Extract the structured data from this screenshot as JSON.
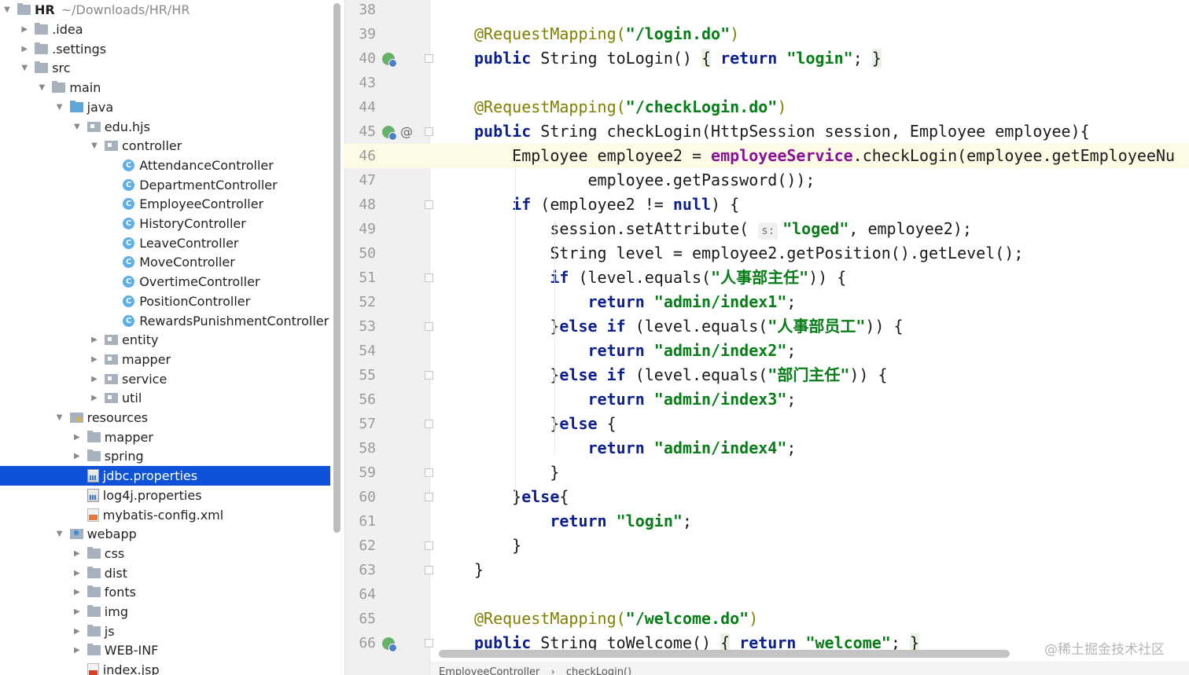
{
  "project": {
    "name": "HR",
    "path": "~/Downloads/HR/HR"
  },
  "tree": [
    {
      "label": "HR",
      "arrow": "▼",
      "icon": "folder",
      "indent": 0,
      "bold": true,
      "path": "~/Downloads/HR/HR"
    },
    {
      "label": ".idea",
      "arrow": "▶",
      "icon": "folder",
      "indent": 1
    },
    {
      "label": ".settings",
      "arrow": "▶",
      "icon": "folder",
      "indent": 1
    },
    {
      "label": "src",
      "arrow": "▼",
      "icon": "folder",
      "indent": 1
    },
    {
      "label": "main",
      "arrow": "▼",
      "icon": "folder",
      "indent": 2
    },
    {
      "label": "java",
      "arrow": "▼",
      "icon": "folder-blue",
      "indent": 3
    },
    {
      "label": "edu.hjs",
      "arrow": "▼",
      "icon": "pkg",
      "indent": 4
    },
    {
      "label": "controller",
      "arrow": "▼",
      "icon": "pkg",
      "indent": 5
    },
    {
      "label": "AttendanceController",
      "arrow": "",
      "icon": "cls",
      "indent": 6
    },
    {
      "label": "DepartmentController",
      "arrow": "",
      "icon": "cls",
      "indent": 6
    },
    {
      "label": "EmployeeController",
      "arrow": "",
      "icon": "cls",
      "indent": 6
    },
    {
      "label": "HistoryController",
      "arrow": "",
      "icon": "cls",
      "indent": 6
    },
    {
      "label": "LeaveController",
      "arrow": "",
      "icon": "cls",
      "indent": 6
    },
    {
      "label": "MoveController",
      "arrow": "",
      "icon": "cls",
      "indent": 6
    },
    {
      "label": "OvertimeController",
      "arrow": "",
      "icon": "cls",
      "indent": 6
    },
    {
      "label": "PositionController",
      "arrow": "",
      "icon": "cls",
      "indent": 6
    },
    {
      "label": "RewardsPunishmentController",
      "arrow": "",
      "icon": "cls",
      "indent": 6
    },
    {
      "label": "entity",
      "arrow": "▶",
      "icon": "pkg",
      "indent": 5
    },
    {
      "label": "mapper",
      "arrow": "▶",
      "icon": "pkg",
      "indent": 5
    },
    {
      "label": "service",
      "arrow": "▶",
      "icon": "pkg",
      "indent": 5
    },
    {
      "label": "util",
      "arrow": "▶",
      "icon": "pkg",
      "indent": 5
    },
    {
      "label": "resources",
      "arrow": "▼",
      "icon": "res",
      "indent": 3
    },
    {
      "label": "mapper",
      "arrow": "▶",
      "icon": "folder",
      "indent": 4
    },
    {
      "label": "spring",
      "arrow": "▶",
      "icon": "folder",
      "indent": 4
    },
    {
      "label": "jdbc.properties",
      "arrow": "",
      "icon": "prop",
      "indent": 4,
      "selected": true
    },
    {
      "label": "log4j.properties",
      "arrow": "",
      "icon": "prop",
      "indent": 4
    },
    {
      "label": "mybatis-config.xml",
      "arrow": "",
      "icon": "xml",
      "indent": 4
    },
    {
      "label": "webapp",
      "arrow": "▼",
      "icon": "web",
      "indent": 3
    },
    {
      "label": "css",
      "arrow": "▶",
      "icon": "folder",
      "indent": 4
    },
    {
      "label": "dist",
      "arrow": "▶",
      "icon": "folder",
      "indent": 4
    },
    {
      "label": "fonts",
      "arrow": "▶",
      "icon": "folder",
      "indent": 4
    },
    {
      "label": "img",
      "arrow": "▶",
      "icon": "folder",
      "indent": 4
    },
    {
      "label": "js",
      "arrow": "▶",
      "icon": "folder",
      "indent": 4
    },
    {
      "label": "WEB-INF",
      "arrow": "▶",
      "icon": "folder",
      "indent": 4
    },
    {
      "label": "index.jsp",
      "arrow": "",
      "icon": "jsp",
      "indent": 4
    }
  ],
  "lines": [
    {
      "n": "38",
      "parts": []
    },
    {
      "n": "39",
      "parts": [
        [
          "ann",
          "@RequestMapping("
        ],
        [
          "str",
          "\"/login.do\""
        ],
        [
          "ann",
          ")"
        ]
      ]
    },
    {
      "n": "40",
      "gutter": "bean",
      "parts": [
        [
          "kw",
          "public "
        ],
        [
          "",
          "String toLogin() "
        ],
        [
          "brace",
          "{"
        ],
        [
          "",
          " "
        ],
        [
          "kw",
          "return "
        ],
        [
          "str",
          "\"login\""
        ],
        [
          "",
          "; "
        ],
        [
          "brace",
          "}"
        ]
      ]
    },
    {
      "n": "43",
      "parts": []
    },
    {
      "n": "44",
      "parts": [
        [
          "ann",
          "@RequestMapping("
        ],
        [
          "str",
          "\"/checkLogin.do\""
        ],
        [
          "ann",
          ")"
        ]
      ]
    },
    {
      "n": "45",
      "gutter": "bean-at",
      "parts": [
        [
          "kw",
          "public "
        ],
        [
          "",
          "String checkLogin(HttpSession session, Employee employee){"
        ]
      ]
    },
    {
      "n": "46",
      "highlight": true,
      "parts": [
        [
          "",
          "    Employee employee2 = "
        ],
        [
          "field",
          "employeeService"
        ],
        [
          "",
          ".checkLogin(employee.getEmployeeNu"
        ]
      ]
    },
    {
      "n": "47",
      "parts": [
        [
          "",
          "            employee.getPassword());"
        ]
      ]
    },
    {
      "n": "48",
      "parts": [
        [
          "",
          "    "
        ],
        [
          "kw",
          "if "
        ],
        [
          "",
          "(employee2 != "
        ],
        [
          "kw",
          "null"
        ],
        [
          "",
          ") {"
        ]
      ]
    },
    {
      "n": "49",
      "parts": [
        [
          "",
          "        session.setAttribute( "
        ],
        [
          "hint",
          "s:"
        ],
        [
          "str",
          "\"loged\""
        ],
        [
          "",
          ", employee2);"
        ]
      ]
    },
    {
      "n": "50",
      "parts": [
        [
          "",
          "        String level = employee2.getPosition().getLevel();"
        ]
      ]
    },
    {
      "n": "51",
      "parts": [
        [
          "",
          "        "
        ],
        [
          "kw",
          "if "
        ],
        [
          "",
          "(level.equals("
        ],
        [
          "str",
          "\"人事部主任\""
        ],
        [
          "",
          ")) {"
        ]
      ]
    },
    {
      "n": "52",
      "parts": [
        [
          "",
          "            "
        ],
        [
          "kw",
          "return "
        ],
        [
          "str",
          "\"admin/index1\""
        ],
        [
          "",
          ";"
        ]
      ]
    },
    {
      "n": "53",
      "parts": [
        [
          "",
          "        }"
        ],
        [
          "kw",
          "else if "
        ],
        [
          "",
          "(level.equals("
        ],
        [
          "str",
          "\"人事部员工\""
        ],
        [
          "",
          ")) {"
        ]
      ]
    },
    {
      "n": "54",
      "parts": [
        [
          "",
          "            "
        ],
        [
          "kw",
          "return "
        ],
        [
          "str",
          "\"admin/index2\""
        ],
        [
          "",
          ";"
        ]
      ]
    },
    {
      "n": "55",
      "parts": [
        [
          "",
          "        }"
        ],
        [
          "kw",
          "else if "
        ],
        [
          "",
          "(level.equals("
        ],
        [
          "str",
          "\"部门主任\""
        ],
        [
          "",
          ")) {"
        ]
      ]
    },
    {
      "n": "56",
      "parts": [
        [
          "",
          "            "
        ],
        [
          "kw",
          "return "
        ],
        [
          "str",
          "\"admin/index3\""
        ],
        [
          "",
          ";"
        ]
      ]
    },
    {
      "n": "57",
      "parts": [
        [
          "",
          "        }"
        ],
        [
          "kw",
          "else "
        ],
        [
          "",
          "{"
        ]
      ]
    },
    {
      "n": "58",
      "parts": [
        [
          "",
          "            "
        ],
        [
          "kw",
          "return "
        ],
        [
          "str",
          "\"admin/index4\""
        ],
        [
          "",
          ";"
        ]
      ]
    },
    {
      "n": "59",
      "parts": [
        [
          "",
          "        }"
        ]
      ]
    },
    {
      "n": "60",
      "parts": [
        [
          "",
          "    }"
        ],
        [
          "kw",
          "else"
        ],
        [
          "",
          "{"
        ]
      ]
    },
    {
      "n": "61",
      "parts": [
        [
          "",
          "        "
        ],
        [
          "kw",
          "return "
        ],
        [
          "str",
          "\"login\""
        ],
        [
          "",
          ";"
        ]
      ]
    },
    {
      "n": "62",
      "parts": [
        [
          "",
          "    }"
        ]
      ]
    },
    {
      "n": "63",
      "parts": [
        [
          "",
          "}"
        ]
      ]
    },
    {
      "n": "64",
      "parts": []
    },
    {
      "n": "65",
      "parts": [
        [
          "ann",
          "@RequestMapping("
        ],
        [
          "str",
          "\"/welcome.do\""
        ],
        [
          "ann",
          ")"
        ]
      ]
    },
    {
      "n": "66",
      "gutter": "bean",
      "parts": [
        [
          "kw",
          "public "
        ],
        [
          "",
          "String toWelcome() "
        ],
        [
          "brace",
          "{"
        ],
        [
          "",
          " "
        ],
        [
          "kw",
          "return "
        ],
        [
          "str",
          "\"welcome\""
        ],
        [
          "",
          "; "
        ],
        [
          "brace",
          "}"
        ]
      ]
    }
  ],
  "breadcrumb": [
    "EmployeeController",
    "›",
    "checkLogin()"
  ],
  "watermark": "@稀土掘金技术社区"
}
